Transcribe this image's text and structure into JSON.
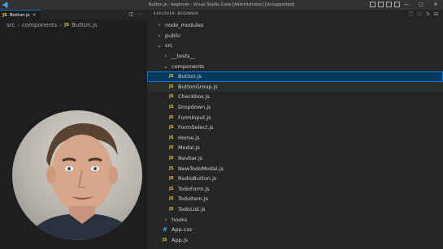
{
  "window": {
    "title": "Button.js - beginner - Visual Studio Code [Administrator] [Unsupported]",
    "controls": {
      "minimize": "—",
      "maximize": "▢",
      "close": "✕"
    }
  },
  "editor": {
    "tab": {
      "badge": "JS",
      "label": "Button.js",
      "close": "×"
    },
    "breadcrumb": {
      "items": [
        "src",
        "components"
      ],
      "file_badge": "JS",
      "file": "Button.js",
      "separator": "›"
    }
  },
  "explorer": {
    "title": "EXPLORER: BEGINNER",
    "tree": [
      {
        "label": "node_modules",
        "type": "folder",
        "expanded": false,
        "depth": 0
      },
      {
        "label": "public",
        "type": "folder",
        "expanded": false,
        "depth": 0
      },
      {
        "label": "src",
        "type": "folder",
        "expanded": true,
        "depth": 0
      },
      {
        "label": "__tests__",
        "type": "folder",
        "expanded": false,
        "depth": 1
      },
      {
        "label": "components",
        "type": "folder",
        "expanded": true,
        "depth": 1
      },
      {
        "label": "Button.js",
        "type": "js",
        "depth": 2,
        "selected": true
      },
      {
        "label": "ButtonGroup.js",
        "type": "js",
        "depth": 2,
        "hover": true
      },
      {
        "label": "Checkbox.js",
        "type": "js",
        "depth": 2
      },
      {
        "label": "Dropdown.js",
        "type": "js",
        "depth": 2
      },
      {
        "label": "FormInput.js",
        "type": "js",
        "depth": 2
      },
      {
        "label": "FormSelect.js",
        "type": "js",
        "depth": 2
      },
      {
        "label": "Home.js",
        "type": "js",
        "depth": 2
      },
      {
        "label": "Modal.js",
        "type": "js",
        "depth": 2
      },
      {
        "label": "Navbar.js",
        "type": "js",
        "depth": 2
      },
      {
        "label": "NewTodoModal.js",
        "type": "js",
        "depth": 2
      },
      {
        "label": "RadioButton.js",
        "type": "js",
        "depth": 2
      },
      {
        "label": "TodoForm.js",
        "type": "js",
        "depth": 2
      },
      {
        "label": "TodoItem.js",
        "type": "js",
        "depth": 2
      },
      {
        "label": "TodoList.js",
        "type": "js",
        "depth": 2
      },
      {
        "label": "hooks",
        "type": "folder",
        "expanded": false,
        "depth": 1
      },
      {
        "label": "App.css",
        "type": "css",
        "depth": 1
      },
      {
        "label": "App.js",
        "type": "js",
        "depth": 1
      }
    ],
    "icons": {
      "js": "JS",
      "css": "#",
      "chevron_right": "›",
      "chevron_down": "⌄"
    }
  },
  "colors": {
    "accent": "#0078d4",
    "selection": "#04395e",
    "js_icon": "#e5c540",
    "css_icon": "#42a5f5"
  }
}
